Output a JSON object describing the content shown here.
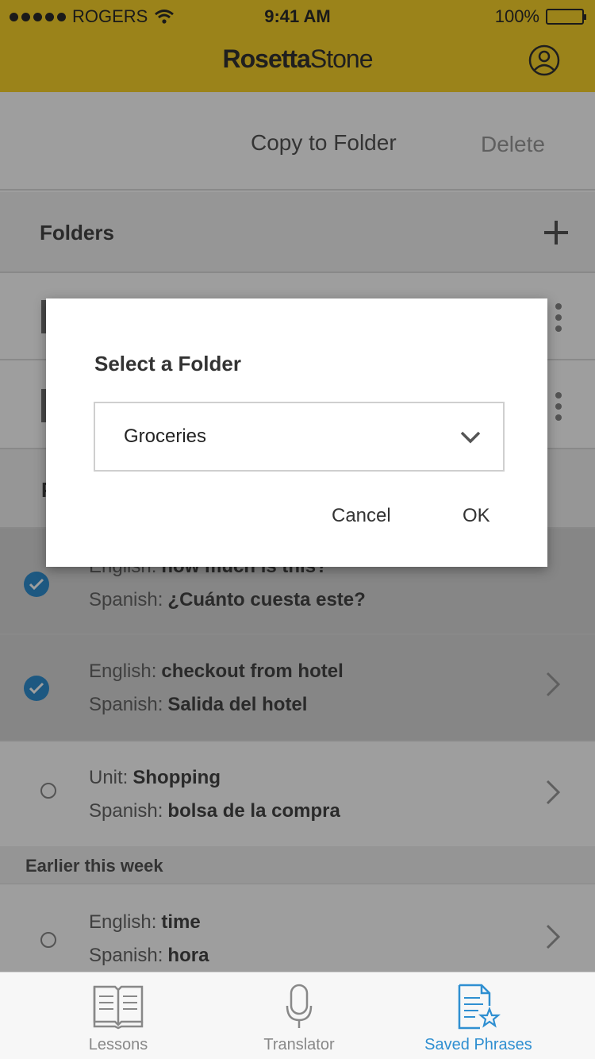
{
  "status": {
    "carrier": "ROGERS",
    "time": "9:41 AM",
    "battery": "100%"
  },
  "app": {
    "brand_bold": "Rosetta",
    "brand_light": "Stone",
    "accent": "#FBD32B"
  },
  "actions": {
    "copy_to_folder": "Copy to Folder",
    "delete": "Delete"
  },
  "folders": {
    "title": "Folders"
  },
  "phrases_header": "P",
  "phrases": [
    {
      "label1": "English:",
      "value1": "how much is this?",
      "label2": "Spanish:",
      "value2": "¿Cuánto cuesta este?",
      "selected": true
    },
    {
      "label1": "English:",
      "value1": "checkout from hotel",
      "label2": "Spanish:",
      "value2": "Salida del hotel",
      "selected": true
    },
    {
      "label1": "Unit:",
      "value1": "Shopping",
      "label2": "Spanish:",
      "value2": "bolsa de la compra",
      "selected": false
    }
  ],
  "earlier": {
    "title": "Earlier this week",
    "items": [
      {
        "label1": "English:",
        "value1": "time",
        "label2": "Spanish:",
        "value2": "hora"
      }
    ]
  },
  "dialog": {
    "title": "Select a Folder",
    "selected_folder": "Groceries",
    "cancel": "Cancel",
    "ok": "OK"
  },
  "tabs": [
    {
      "label": "Lessons",
      "icon": "book-icon",
      "active": false
    },
    {
      "label": "Translator",
      "icon": "microphone-icon",
      "active": false
    },
    {
      "label": "Saved Phrases",
      "icon": "saved-phrases-icon",
      "active": true
    }
  ],
  "colors": {
    "accent_blue": "#2f8fd1"
  }
}
